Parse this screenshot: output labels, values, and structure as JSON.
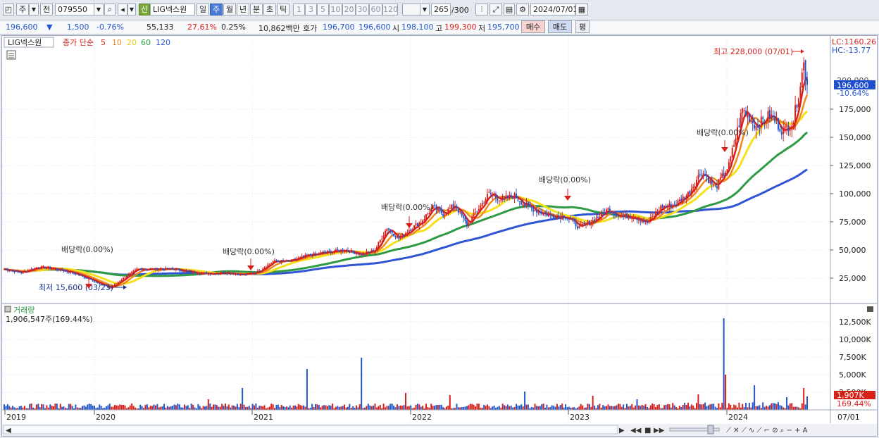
{
  "toolbar": {
    "market_label": "주",
    "prev_label": "전",
    "stock_code": "079550",
    "new_badge": "신",
    "stock_name": "LIG넥스원",
    "period_tabs": [
      "일",
      "주",
      "월",
      "년",
      "분",
      "초",
      "틱"
    ],
    "active_period": "주",
    "interval_buttons": [
      "1",
      "3",
      "5",
      "10",
      "20",
      "30",
      "60",
      "120"
    ],
    "count_value": "265",
    "count_total": "/300",
    "date_value": "2024/07/01"
  },
  "quote": {
    "price": "196,600",
    "change_arrow": "▼",
    "change": "1,500",
    "change_pct": "-0.76%",
    "volume": "55,133",
    "turnover_ratio": "27.61%",
    "vol_ratio": "0.25%",
    "amount": "10,862백만",
    "bid_ask_label": "호가",
    "ask": "196,700",
    "bid": "196,600",
    "open_label": "시",
    "open": "198,100",
    "high_label": "고",
    "high": "199,300",
    "low_label": "저",
    "low": "195,700",
    "buy_label": "매수",
    "sell_label": "매도",
    "avg_label": "평"
  },
  "legend": {
    "name": "LIG넥스원",
    "close_label": "종가 단순",
    "ma": [
      "5",
      "10",
      "20",
      "60",
      "120"
    ]
  },
  "price_axis": {
    "ticks": [
      "175,000",
      "150,000",
      "125,000",
      "100,000",
      "75,000",
      "50,000",
      "25,000"
    ],
    "lc": "LC:1160.26",
    "hc": "HC:-13.77",
    "current": "196,600",
    "current_pct": "-10.64%",
    "covered_tick": "200,000"
  },
  "annotations": {
    "high": "최고 228,000 (07/01)",
    "low": "최저 15,600 (03/23)",
    "dividend": "배당락(0.00%)"
  },
  "volume_panel": {
    "title": "거래량",
    "value": "1,906,547주(169.44%)",
    "ticks": [
      "12,500K",
      "10,000K",
      "7,500K",
      "5,000K",
      "2,500K"
    ],
    "current": "1,907K",
    "current_pct": "169.44%"
  },
  "date_axis": {
    "labels": [
      "2019",
      "2020",
      "2021",
      "2022",
      "2023",
      "2024"
    ],
    "end_label": "07/01"
  },
  "colors": {
    "up": "#d9201a",
    "down": "#2457c9",
    "ma5": "#d9201a",
    "ma10": "#f08a1c",
    "ma20": "#f5e11b",
    "ma60": "#2e9a44",
    "ma120": "#2f55d4"
  },
  "chart_data": {
    "type": "candlestick",
    "x_start": "2018-12",
    "x_end": "2024-07-01",
    "ylim": [
      0,
      240000
    ],
    "close_anchors": [
      [
        0,
        33000
      ],
      [
        10,
        30000
      ],
      [
        20,
        35000
      ],
      [
        30,
        33000
      ],
      [
        40,
        30000
      ],
      [
        55,
        21000
      ],
      [
        62,
        16000
      ],
      [
        70,
        25000
      ],
      [
        78,
        33000
      ],
      [
        90,
        33000
      ],
      [
        100,
        33000
      ],
      [
        110,
        30000
      ],
      [
        120,
        29000
      ],
      [
        130,
        30000
      ],
      [
        140,
        28000
      ],
      [
        148,
        30000
      ],
      [
        158,
        40000
      ],
      [
        168,
        40000
      ],
      [
        178,
        45000
      ],
      [
        190,
        48000
      ],
      [
        200,
        50000
      ],
      [
        210,
        46000
      ],
      [
        218,
        50000
      ],
      [
        225,
        70000
      ],
      [
        232,
        60000
      ],
      [
        238,
        68000
      ],
      [
        245,
        75000
      ],
      [
        252,
        88000
      ],
      [
        258,
        82000
      ],
      [
        265,
        90000
      ],
      [
        272,
        72000
      ],
      [
        278,
        85000
      ],
      [
        285,
        100000
      ],
      [
        292,
        95000
      ],
      [
        300,
        98000
      ],
      [
        306,
        90000
      ],
      [
        314,
        84000
      ],
      [
        322,
        80000
      ],
      [
        330,
        80000
      ],
      [
        338,
        70000
      ],
      [
        346,
        76000
      ],
      [
        355,
        86000
      ],
      [
        362,
        80000
      ],
      [
        370,
        80000
      ],
      [
        378,
        74000
      ],
      [
        386,
        88000
      ],
      [
        394,
        90000
      ],
      [
        402,
        100000
      ],
      [
        410,
        120000
      ],
      [
        418,
        105000
      ],
      [
        426,
        125000
      ],
      [
        434,
        175000
      ],
      [
        442,
        160000
      ],
      [
        450,
        170000
      ],
      [
        458,
        155000
      ],
      [
        464,
        165000
      ],
      [
        470,
        215000
      ],
      [
        472,
        196600
      ]
    ],
    "total_weeks": 473,
    "volume_spikes_K": [
      [
        120,
        1500
      ],
      [
        140,
        3100
      ],
      [
        178,
        5800
      ],
      [
        210,
        7400
      ],
      [
        236,
        2400
      ],
      [
        262,
        2100
      ],
      [
        306,
        2600
      ],
      [
        346,
        2000
      ],
      [
        372,
        1500
      ],
      [
        408,
        2200
      ],
      [
        423,
        13000
      ],
      [
        424,
        5000
      ],
      [
        441,
        3500
      ],
      [
        460,
        1800
      ],
      [
        470,
        3100
      ],
      [
        472,
        1907
      ]
    ]
  }
}
